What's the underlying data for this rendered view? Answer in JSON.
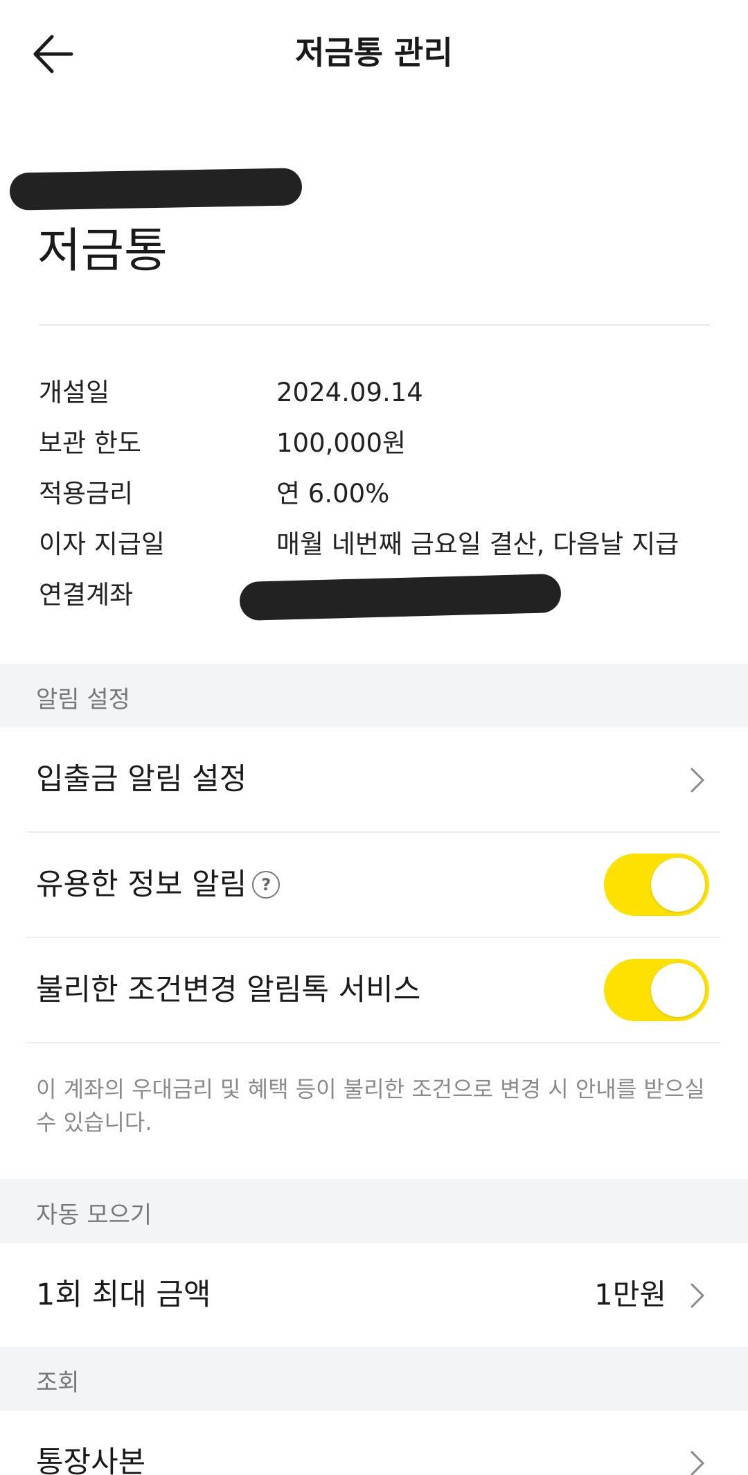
{
  "header": {
    "title": "저금통 관리",
    "back_icon": "arrow-left-icon"
  },
  "account": {
    "name": "저금통"
  },
  "info": [
    {
      "label": "개설일",
      "value": "2024.09.14"
    },
    {
      "label": "보관 한도",
      "value": "100,000원"
    },
    {
      "label": "적용금리",
      "value": "연 6.00%"
    },
    {
      "label": "이자 지급일",
      "value": "매월 네번째 금요일 결산, 다음날 지급"
    },
    {
      "label": "연결계좌",
      "value": ""
    }
  ],
  "sections": {
    "alerts": {
      "label": "알림 설정",
      "deposit_alert": "입출금 알림 설정",
      "useful_info": "유용한 정보 알림",
      "useful_info_on": true,
      "unfavorable_change": "불리한 조건변경 알림톡 서비스",
      "unfavorable_change_on": true,
      "notice": "이 계좌의 우대금리 및 혜택 등이 불리한 조건으로 변경 시 안내를 받으실 수 있습니다."
    },
    "auto_save": {
      "label": "자동 모으기",
      "max_amount_label": "1회 최대 금액",
      "max_amount_value": "1만원"
    },
    "inquiry": {
      "label": "조회",
      "passbook_copy": "통장사본"
    }
  },
  "colors": {
    "toggle_on": "#ffe100",
    "section_bg": "#f3f4f5"
  }
}
